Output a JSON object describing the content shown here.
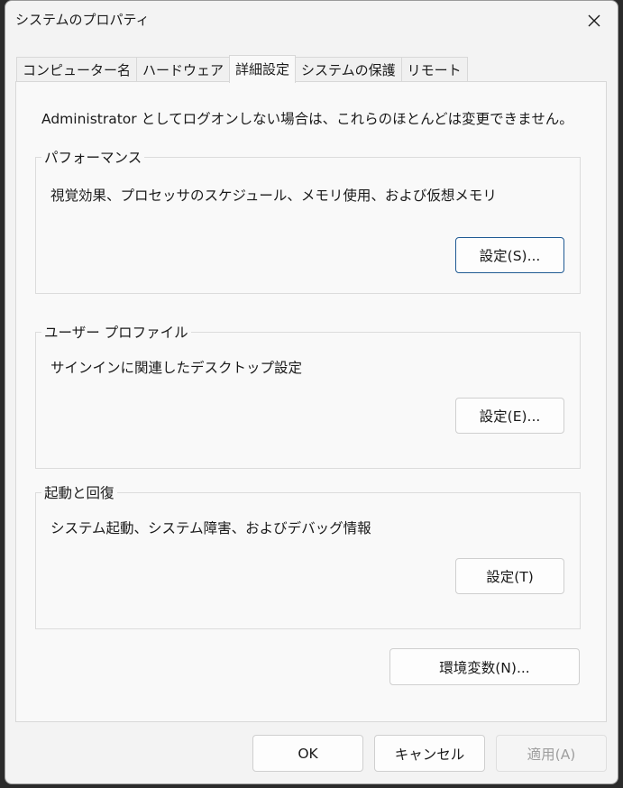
{
  "window": {
    "title": "システムのプロパティ"
  },
  "tabs": [
    {
      "label": "コンピューター名",
      "active": false
    },
    {
      "label": "ハードウェア",
      "active": false
    },
    {
      "label": "詳細設定",
      "active": true
    },
    {
      "label": "システムの保護",
      "active": false
    },
    {
      "label": "リモート",
      "active": false
    }
  ],
  "note": "Administrator としてログオンしない場合は、これらのほとんどは変更できません。",
  "performance": {
    "label": "パフォーマンス",
    "desc": "視覚効果、プロセッサのスケジュール、メモリ使用、および仮想メモリ",
    "button": "設定(S)..."
  },
  "user_profile": {
    "label": "ユーザー プロファイル",
    "desc": "サインインに関連したデスクトップ設定",
    "button": "設定(E)..."
  },
  "startup": {
    "label": "起動と回復",
    "desc": "システム起動、システム障害、およびデバッグ情報",
    "button": "設定(T)"
  },
  "env_button": "環境変数(N)...",
  "footer": {
    "ok": "OK",
    "cancel": "キャンセル",
    "apply": "適用(A)"
  },
  "icons": {
    "close": "close-icon"
  },
  "colors": {
    "focus_border": "#1f5a93",
    "panel_bg": "#f9f9f9",
    "window_bg": "#f3f3f3"
  }
}
